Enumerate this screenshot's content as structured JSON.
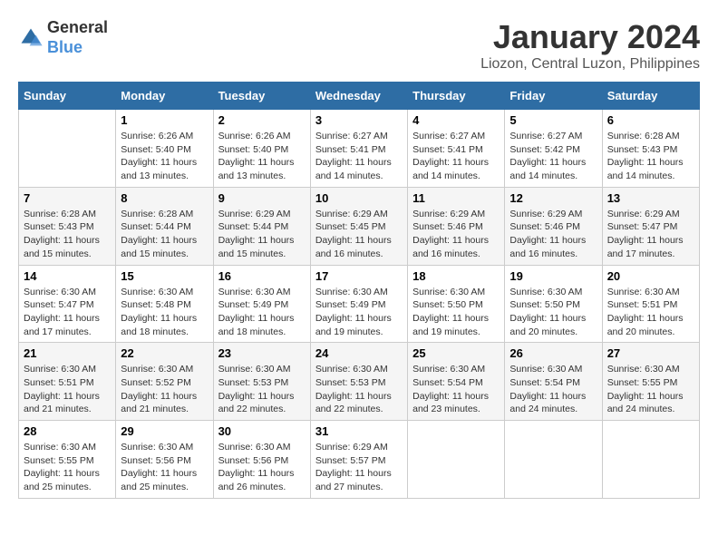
{
  "logo": {
    "text_general": "General",
    "text_blue": "Blue"
  },
  "title": "January 2024",
  "location": "Liozon, Central Luzon, Philippines",
  "days_of_week": [
    "Sunday",
    "Monday",
    "Tuesday",
    "Wednesday",
    "Thursday",
    "Friday",
    "Saturday"
  ],
  "weeks": [
    [
      {
        "day": "",
        "sunrise": "",
        "sunset": "",
        "daylight": ""
      },
      {
        "day": "1",
        "sunrise": "Sunrise: 6:26 AM",
        "sunset": "Sunset: 5:40 PM",
        "daylight": "Daylight: 11 hours and 13 minutes."
      },
      {
        "day": "2",
        "sunrise": "Sunrise: 6:26 AM",
        "sunset": "Sunset: 5:40 PM",
        "daylight": "Daylight: 11 hours and 13 minutes."
      },
      {
        "day": "3",
        "sunrise": "Sunrise: 6:27 AM",
        "sunset": "Sunset: 5:41 PM",
        "daylight": "Daylight: 11 hours and 14 minutes."
      },
      {
        "day": "4",
        "sunrise": "Sunrise: 6:27 AM",
        "sunset": "Sunset: 5:41 PM",
        "daylight": "Daylight: 11 hours and 14 minutes."
      },
      {
        "day": "5",
        "sunrise": "Sunrise: 6:27 AM",
        "sunset": "Sunset: 5:42 PM",
        "daylight": "Daylight: 11 hours and 14 minutes."
      },
      {
        "day": "6",
        "sunrise": "Sunrise: 6:28 AM",
        "sunset": "Sunset: 5:43 PM",
        "daylight": "Daylight: 11 hours and 14 minutes."
      }
    ],
    [
      {
        "day": "7",
        "sunrise": "Sunrise: 6:28 AM",
        "sunset": "Sunset: 5:43 PM",
        "daylight": "Daylight: 11 hours and 15 minutes."
      },
      {
        "day": "8",
        "sunrise": "Sunrise: 6:28 AM",
        "sunset": "Sunset: 5:44 PM",
        "daylight": "Daylight: 11 hours and 15 minutes."
      },
      {
        "day": "9",
        "sunrise": "Sunrise: 6:29 AM",
        "sunset": "Sunset: 5:44 PM",
        "daylight": "Daylight: 11 hours and 15 minutes."
      },
      {
        "day": "10",
        "sunrise": "Sunrise: 6:29 AM",
        "sunset": "Sunset: 5:45 PM",
        "daylight": "Daylight: 11 hours and 16 minutes."
      },
      {
        "day": "11",
        "sunrise": "Sunrise: 6:29 AM",
        "sunset": "Sunset: 5:46 PM",
        "daylight": "Daylight: 11 hours and 16 minutes."
      },
      {
        "day": "12",
        "sunrise": "Sunrise: 6:29 AM",
        "sunset": "Sunset: 5:46 PM",
        "daylight": "Daylight: 11 hours and 16 minutes."
      },
      {
        "day": "13",
        "sunrise": "Sunrise: 6:29 AM",
        "sunset": "Sunset: 5:47 PM",
        "daylight": "Daylight: 11 hours and 17 minutes."
      }
    ],
    [
      {
        "day": "14",
        "sunrise": "Sunrise: 6:30 AM",
        "sunset": "Sunset: 5:47 PM",
        "daylight": "Daylight: 11 hours and 17 minutes."
      },
      {
        "day": "15",
        "sunrise": "Sunrise: 6:30 AM",
        "sunset": "Sunset: 5:48 PM",
        "daylight": "Daylight: 11 hours and 18 minutes."
      },
      {
        "day": "16",
        "sunrise": "Sunrise: 6:30 AM",
        "sunset": "Sunset: 5:49 PM",
        "daylight": "Daylight: 11 hours and 18 minutes."
      },
      {
        "day": "17",
        "sunrise": "Sunrise: 6:30 AM",
        "sunset": "Sunset: 5:49 PM",
        "daylight": "Daylight: 11 hours and 19 minutes."
      },
      {
        "day": "18",
        "sunrise": "Sunrise: 6:30 AM",
        "sunset": "Sunset: 5:50 PM",
        "daylight": "Daylight: 11 hours and 19 minutes."
      },
      {
        "day": "19",
        "sunrise": "Sunrise: 6:30 AM",
        "sunset": "Sunset: 5:50 PM",
        "daylight": "Daylight: 11 hours and 20 minutes."
      },
      {
        "day": "20",
        "sunrise": "Sunrise: 6:30 AM",
        "sunset": "Sunset: 5:51 PM",
        "daylight": "Daylight: 11 hours and 20 minutes."
      }
    ],
    [
      {
        "day": "21",
        "sunrise": "Sunrise: 6:30 AM",
        "sunset": "Sunset: 5:51 PM",
        "daylight": "Daylight: 11 hours and 21 minutes."
      },
      {
        "day": "22",
        "sunrise": "Sunrise: 6:30 AM",
        "sunset": "Sunset: 5:52 PM",
        "daylight": "Daylight: 11 hours and 21 minutes."
      },
      {
        "day": "23",
        "sunrise": "Sunrise: 6:30 AM",
        "sunset": "Sunset: 5:53 PM",
        "daylight": "Daylight: 11 hours and 22 minutes."
      },
      {
        "day": "24",
        "sunrise": "Sunrise: 6:30 AM",
        "sunset": "Sunset: 5:53 PM",
        "daylight": "Daylight: 11 hours and 22 minutes."
      },
      {
        "day": "25",
        "sunrise": "Sunrise: 6:30 AM",
        "sunset": "Sunset: 5:54 PM",
        "daylight": "Daylight: 11 hours and 23 minutes."
      },
      {
        "day": "26",
        "sunrise": "Sunrise: 6:30 AM",
        "sunset": "Sunset: 5:54 PM",
        "daylight": "Daylight: 11 hours and 24 minutes."
      },
      {
        "day": "27",
        "sunrise": "Sunrise: 6:30 AM",
        "sunset": "Sunset: 5:55 PM",
        "daylight": "Daylight: 11 hours and 24 minutes."
      }
    ],
    [
      {
        "day": "28",
        "sunrise": "Sunrise: 6:30 AM",
        "sunset": "Sunset: 5:55 PM",
        "daylight": "Daylight: 11 hours and 25 minutes."
      },
      {
        "day": "29",
        "sunrise": "Sunrise: 6:30 AM",
        "sunset": "Sunset: 5:56 PM",
        "daylight": "Daylight: 11 hours and 25 minutes."
      },
      {
        "day": "30",
        "sunrise": "Sunrise: 6:30 AM",
        "sunset": "Sunset: 5:56 PM",
        "daylight": "Daylight: 11 hours and 26 minutes."
      },
      {
        "day": "31",
        "sunrise": "Sunrise: 6:29 AM",
        "sunset": "Sunset: 5:57 PM",
        "daylight": "Daylight: 11 hours and 27 minutes."
      },
      {
        "day": "",
        "sunrise": "",
        "sunset": "",
        "daylight": ""
      },
      {
        "day": "",
        "sunrise": "",
        "sunset": "",
        "daylight": ""
      },
      {
        "day": "",
        "sunrise": "",
        "sunset": "",
        "daylight": ""
      }
    ]
  ]
}
